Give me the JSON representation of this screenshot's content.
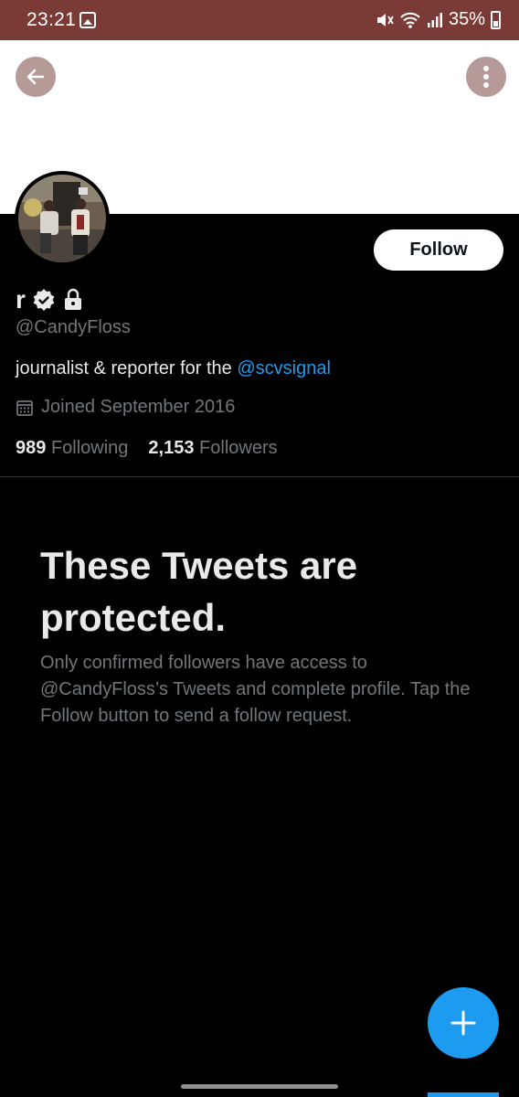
{
  "status_bar": {
    "time": "23:21",
    "battery": "35%",
    "icons": [
      "gallery-icon",
      "mute-icon",
      "wifi-icon",
      "signal-icon",
      "battery-icon"
    ]
  },
  "header": {
    "back_icon": "arrow-left-icon",
    "more_icon": "more-vertical-icon"
  },
  "profile": {
    "name": "r",
    "badges": [
      "verified-icon",
      "lock-icon"
    ],
    "handle": "@CandyFloss",
    "bio_text": "journalist & reporter for the ",
    "bio_mention": "@scvsignal",
    "joined": "Joined September 2016",
    "following_count": "989",
    "following_label": "Following",
    "followers_count": "2,153",
    "followers_label": "Followers",
    "follow_button": "Follow"
  },
  "protected": {
    "title": "These Tweets are protected.",
    "body": "Only confirmed followers have access to @CandyFloss’s Tweets and complete profile. Tap the Follow button to send a follow request."
  },
  "fab": {
    "icon": "plus-icon"
  },
  "colors": {
    "status_bar": "#7a3a36",
    "accent": "#1d9bf0",
    "banner": "#ffffff",
    "background": "#000000"
  }
}
